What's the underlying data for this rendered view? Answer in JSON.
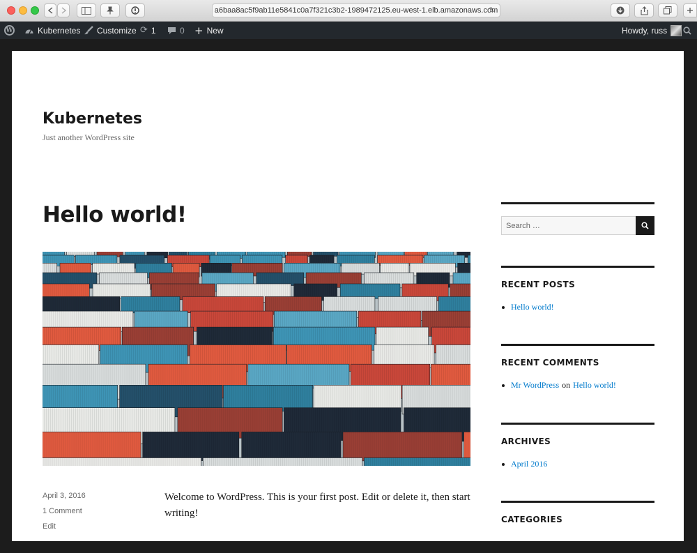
{
  "browser": {
    "url": "a6baa8ac5f9ab11e5841c0a7f321c3b2-1989472125.eu-west-1.elb.amazonaws.com"
  },
  "adminbar": {
    "site_name": "Kubernetes",
    "customize": "Customize",
    "updates_count": "1",
    "comments_count": "0",
    "new_label": "New",
    "howdy": "Howdy, russ"
  },
  "site": {
    "title": "Kubernetes",
    "description": "Just another WordPress site"
  },
  "post": {
    "title": "Hello world!",
    "date": "April 3, 2016",
    "comments": "1 Comment",
    "edit": "Edit",
    "content": "Welcome to WordPress. This is your first post. Edit or delete it, then start writing!"
  },
  "sidebar": {
    "search_placeholder": "Search …",
    "recent_posts_title": "RECENT POSTS",
    "recent_posts": [
      "Hello world!"
    ],
    "recent_comments_title": "RECENT COMMENTS",
    "recent_comment_author": "Mr WordPress",
    "recent_comment_on": "on",
    "recent_comment_post": "Hello world!",
    "archives_title": "ARCHIVES",
    "archives": [
      "April 2016"
    ],
    "categories_title": "CATEGORIES"
  },
  "colors": {
    "link": "#007acc",
    "adminbar": "#23282d",
    "text": "#1a1a1a"
  },
  "icons": {
    "wp_logo": "wordpress-logo-icon",
    "dashboard": "dashboard-icon",
    "customize": "brush-icon",
    "updates": "refresh-icon",
    "comments": "comment-bubble-icon",
    "new": "plus-icon",
    "search": "search-icon"
  }
}
